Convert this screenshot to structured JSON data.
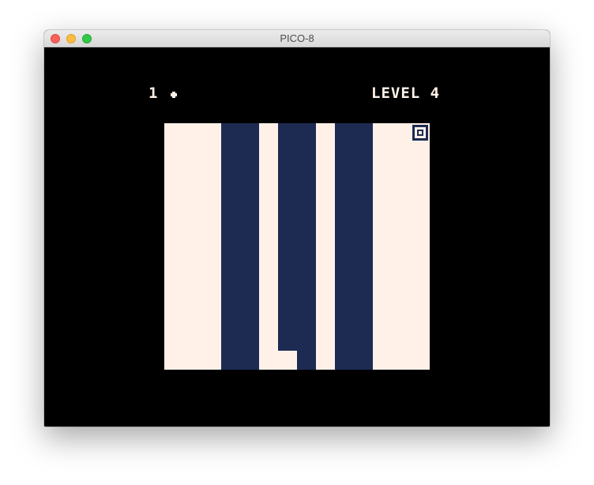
{
  "window": {
    "title": "PICO-8"
  },
  "hud": {
    "count": "1",
    "level": "LEVEL 4"
  },
  "colors": {
    "light": "#fff1e8",
    "dark": "#1d2b53",
    "background": "#000000"
  },
  "icons": {
    "coin": "coin-icon",
    "goal": "goal-target-icon",
    "player": "player-sprite"
  }
}
